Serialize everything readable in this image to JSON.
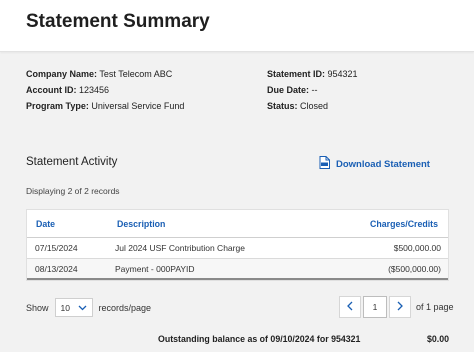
{
  "page_title": "Statement Summary",
  "info": {
    "company_name": {
      "label": "Company Name:",
      "value": "Test Telecom ABC"
    },
    "account_id": {
      "label": "Account ID:",
      "value": "123456"
    },
    "program_type": {
      "label": "Program Type:",
      "value": "Universal Service Fund"
    },
    "statement_id": {
      "label": "Statement ID:",
      "value": "954321"
    },
    "due_date": {
      "label": "Due Date:",
      "value": "--"
    },
    "status": {
      "label": "Status:",
      "value": "Closed"
    }
  },
  "activity": {
    "title": "Statement Activity",
    "download_label": "Download Statement",
    "download_icon": "pdf-file-icon",
    "records_text": "Displaying 2 of 2 records"
  },
  "table": {
    "columns": {
      "date": "Date",
      "description": "Description",
      "charges": "Charges/Credits"
    },
    "rows": [
      {
        "date": "07/15/2024",
        "description": "Jul 2024 USF Contribution Charge",
        "amount": "$500,000.00"
      },
      {
        "date": "08/13/2024",
        "description": "Payment - 000PAYID",
        "amount": "($500,000.00)"
      }
    ]
  },
  "pager": {
    "show_label": "Show",
    "page_size": "10",
    "per_page_label": "records/page",
    "current_page": "1",
    "of_pages": "of 1 page"
  },
  "footer": {
    "outstanding_label": "Outstanding balance as of 09/10/2024 for 954321",
    "outstanding_amount": "$0.00"
  },
  "colors": {
    "accent": "#1a5fb4",
    "background": "#f2f2f2",
    "header_background": "#ffffff"
  }
}
